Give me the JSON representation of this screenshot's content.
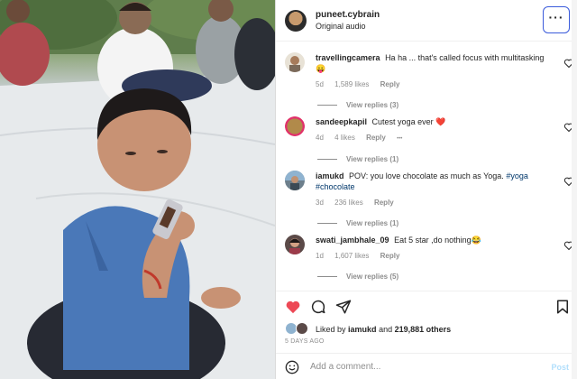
{
  "post": {
    "username": "puneet.cybrain",
    "audio": "Original audio",
    "more_icon": "more-horizontal-icon"
  },
  "comments": [
    {
      "username": "travellingcamera",
      "text": "Ha ha ... that's called focus with multitasking 😛",
      "time": "5d",
      "likes": "1,589 likes",
      "reply": "Reply",
      "view_replies": "View replies (3)",
      "avatar_color": "#e8e2d6"
    },
    {
      "username": "sandeepkapil",
      "text": "Cutest yoga ever ❤️",
      "time": "4d",
      "likes": "4 likes",
      "reply": "Reply",
      "options": "•••",
      "view_replies": "View replies (1)",
      "avatar_color": "#b18a4a"
    },
    {
      "username": "iamukd",
      "text_prefix": "POV: you love chocolate as much as Yoga.",
      "hashtag1": "#yoga",
      "hashtag2": "#chocolate",
      "time": "3d",
      "likes": "236 likes",
      "reply": "Reply",
      "view_replies": "View replies (1)",
      "avatar_color": "#6d7f8c"
    },
    {
      "username": "swati_jambhale_09",
      "text": "Eat 5 star ,do nothing😂",
      "time": "1d",
      "likes": "1,607 likes",
      "reply": "Reply",
      "view_replies": "View replies (5)",
      "avatar_color": "#5b4a48"
    }
  ],
  "actions": {
    "like_icon": "heart-filled-icon",
    "comment_icon": "comment-icon",
    "share_icon": "send-icon",
    "save_icon": "bookmark-icon"
  },
  "likes": {
    "prefix": "Liked by",
    "user": "iamukd",
    "middle": "and",
    "count": "219,881 others"
  },
  "date": "5 DAYS AGO",
  "add_comment": {
    "placeholder": "Add a comment...",
    "post_label": "Post",
    "emoji_icon": "emoji-icon"
  },
  "colors": {
    "like_red": "#ed4956",
    "link_blue": "#00376b",
    "muted": "#8e8e8e",
    "post_disabled": "#b2dffc"
  }
}
